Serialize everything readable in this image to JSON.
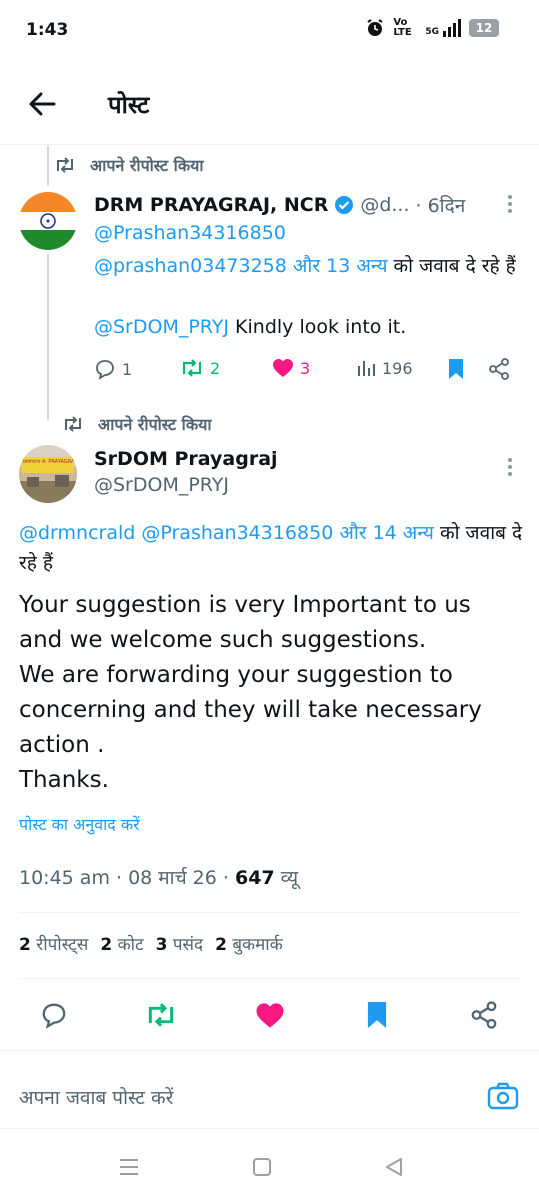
{
  "status_bar": {
    "time": "1:43",
    "network": "Vo LTE",
    "signal_label": "5G",
    "battery": "12"
  },
  "header": {
    "title": "पोस्ट"
  },
  "parent_post": {
    "repost_label": "आपने रीपोस्ट किया",
    "author_name": "DRM PRAYAGRAJ, NCR",
    "handle": "@d...",
    "time": "· 6दिन",
    "mention_line1": "@Prashan34316850",
    "reply_to_mention": "@prashan03473258 और 13 अन्य",
    "reply_to_suffix": " को जवाब दे रहे हैं",
    "body_mention": "@SrDOM_PRYJ",
    "body_text": " Kindly look into it.",
    "stats": {
      "replies": "1",
      "reposts": "2",
      "likes": "3",
      "views": "196"
    }
  },
  "main_post": {
    "repost_label": "आपने रीपोस्ट किया",
    "author_name": "SrDOM Prayagraj",
    "handle": "@SrDOM_PRYJ",
    "avatar_text": "प्रयागराज जं. PRAYAGRAJ JN.",
    "reply_to_mention": "@drmncrald @Prashan34316850 और 14 अन्य",
    "reply_to_suffix": " को जवाब दे रहे हैं",
    "body_lines": [
      "Your suggestion is very Important to us",
      "and we welcome such suggestions.",
      "We are forwarding your suggestion to",
      "concerning and they will take necessary",
      "action .",
      "Thanks."
    ],
    "translate_label": "पोस्ट का अनुवाद करें",
    "timestamp": "10:45 am · 08 मार्च 26 · ",
    "views_count": "647",
    "views_label": " व्यू",
    "counts": [
      {
        "value": "2",
        "label": "रीपोस्ट्स"
      },
      {
        "value": "2",
        "label": "कोट"
      },
      {
        "value": "3",
        "label": "पसंद"
      },
      {
        "value": "2",
        "label": "बुकमार्क"
      }
    ]
  },
  "reply_bar": {
    "placeholder": "अपना जवाब पोस्ट करें"
  },
  "colors": {
    "accent": "#1d9bf0",
    "repost_green": "#00ba7c",
    "like_pink": "#f91880",
    "text_primary": "#0f1419",
    "text_secondary": "#536471"
  },
  "icons": [
    "back-arrow-icon",
    "repost-icon",
    "verified-badge-icon",
    "more-options-icon",
    "reply-icon",
    "like-icon",
    "views-icon",
    "bookmark-icon",
    "share-icon",
    "camera-icon",
    "alarm-icon",
    "nav-menu-icon",
    "nav-home-icon",
    "nav-back-icon"
  ]
}
